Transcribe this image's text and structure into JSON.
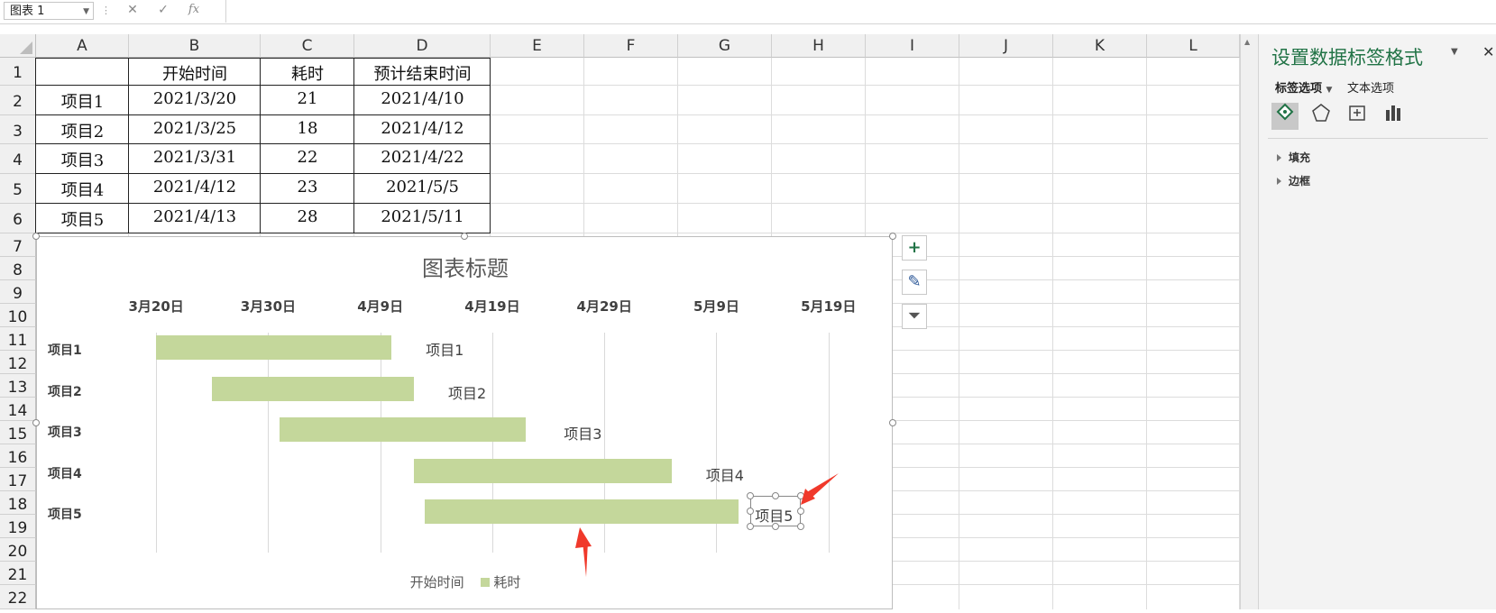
{
  "formula_bar": {
    "name_box": "图表 1",
    "cancel_icon": "✕",
    "enter_icon": "✓",
    "fx_label": "fx"
  },
  "columns": [
    "A",
    "B",
    "C",
    "D",
    "E",
    "F",
    "G",
    "H",
    "I",
    "J",
    "K",
    "L"
  ],
  "rows": [
    "1",
    "2",
    "3",
    "4",
    "5",
    "6",
    "7",
    "8",
    "9",
    "10",
    "11",
    "12",
    "13",
    "14",
    "15",
    "16",
    "17",
    "18",
    "19",
    "20",
    "21",
    "22"
  ],
  "table": {
    "headers": [
      "",
      "开始时间",
      "耗时",
      "预计结束时间"
    ],
    "rows": [
      [
        "项目1",
        "2021/3/20",
        "21",
        "2021/4/10"
      ],
      [
        "项目2",
        "2021/3/25",
        "18",
        "2021/4/12"
      ],
      [
        "项目3",
        "2021/3/31",
        "22",
        "2021/4/22"
      ],
      [
        "项目4",
        "2021/4/12",
        "23",
        "2021/5/5"
      ],
      [
        "项目5",
        "2021/4/13",
        "28",
        "2021/5/11"
      ]
    ]
  },
  "chart_data": {
    "type": "bar",
    "orientation": "horizontal",
    "stacked": true,
    "title": "图表标题",
    "categories": [
      "项目1",
      "项目2",
      "项目3",
      "项目4",
      "项目5"
    ],
    "x_tick_labels": [
      "3月20日",
      "3月30日",
      "4月9日",
      "4月19日",
      "4月29日",
      "5月9日",
      "5月19日"
    ],
    "x_axis_position": "top",
    "x_range": [
      "2021-03-15",
      "2021-05-22"
    ],
    "series": [
      {
        "name": "开始时间",
        "values": [
          "2021-03-20",
          "2021-03-25",
          "2021-03-31",
          "2021-04-12",
          "2021-04-13"
        ],
        "fill": "none"
      },
      {
        "name": "耗时",
        "values": [
          21,
          18,
          22,
          23,
          28
        ],
        "color": "#c4d79b"
      }
    ],
    "data_labels": [
      "项目1",
      "项目2",
      "项目3",
      "项目4",
      "项目5"
    ],
    "legend": "bottom",
    "grid": true
  },
  "chart_buttons": {
    "add": "+",
    "style": "✎",
    "filter": "⏷"
  },
  "pane": {
    "title": "设置数据标签格式",
    "tab_label_options": "标签选项",
    "tab_text_options": "文本选项",
    "sections": [
      "填充",
      "边框"
    ],
    "icons": [
      "fill-icon",
      "pentagon-icon",
      "size-icon",
      "bar-chart-icon"
    ]
  }
}
